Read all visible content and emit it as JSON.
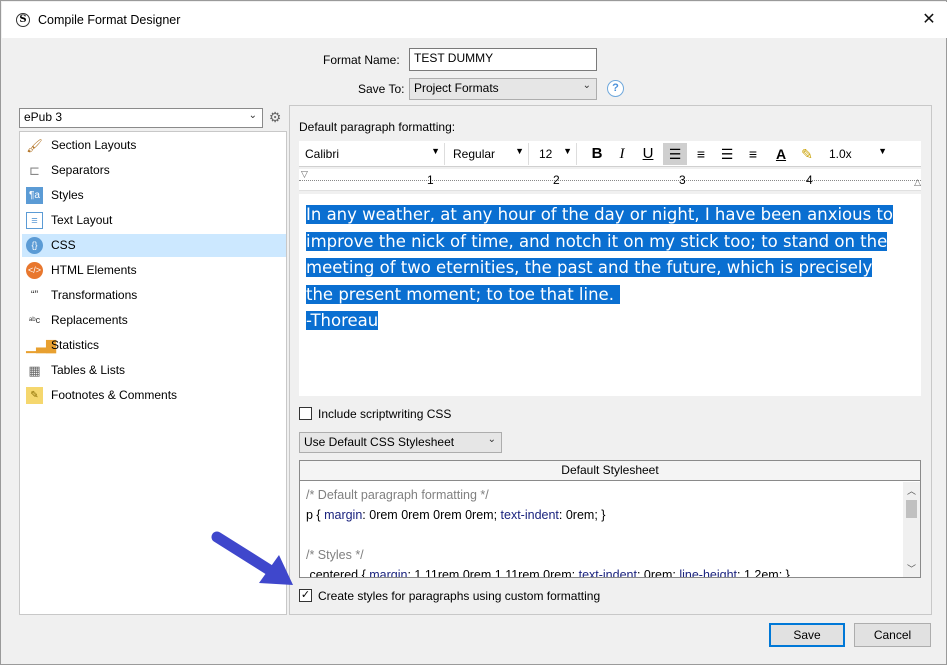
{
  "window": {
    "title": "Compile Format Designer",
    "app_icon_letter": "S"
  },
  "header": {
    "format_name_label": "Format Name:",
    "format_name_value": "TEST DUMMY",
    "save_to_label": "Save To:",
    "save_to_value": "Project Formats",
    "help_glyph": "?"
  },
  "sidebar": {
    "format_select": "ePub 3",
    "items": [
      {
        "label": "Section Layouts",
        "icon": "brush-icon"
      },
      {
        "label": "Separators",
        "icon": "separator-icon"
      },
      {
        "label": "Styles",
        "icon": "styles-icon"
      },
      {
        "label": "Text Layout",
        "icon": "text-layout-icon"
      },
      {
        "label": "CSS",
        "icon": "css-icon"
      },
      {
        "label": "HTML Elements",
        "icon": "html-icon"
      },
      {
        "label": "Transformations",
        "icon": "transformations-icon"
      },
      {
        "label": "Replacements",
        "icon": "replacements-icon"
      },
      {
        "label": "Statistics",
        "icon": "statistics-icon"
      },
      {
        "label": "Tables & Lists",
        "icon": "table-icon"
      },
      {
        "label": "Footnotes & Comments",
        "icon": "footnote-icon"
      }
    ],
    "selected_index": 4
  },
  "editor": {
    "heading": "Default paragraph formatting:",
    "font": "Calibri",
    "style": "Regular",
    "size": "12",
    "line_spacing": "1.0x",
    "ruler_numbers": [
      "1",
      "2",
      "3",
      "4"
    ],
    "lines": [
      "In any weather, at any hour of the day or night, I have been anxious to",
      "improve the nick of time, and notch it on my stick too; to stand on the",
      "meeting of two eternities, the past and the future, which is precisely",
      "the present moment; to toe that line.",
      "-Thoreau"
    ]
  },
  "css": {
    "include_scriptwriting_label": "Include scriptwriting CSS",
    "include_scriptwriting_checked": false,
    "stylesheet_select": "Use Default CSS Stylesheet",
    "stylesheet_header": "Default Stylesheet",
    "code": {
      "comment1": "/* Default paragraph formatting */",
      "line2_selector": "p { ",
      "line2_prop1": "margin",
      "line2_val1": ": 0rem 0rem 0rem 0rem;  ",
      "line2_prop2": "text-indent",
      "line2_val2": ": 0rem; }",
      "comment2": "/* Styles */",
      "line4_selector": ".centered { ",
      "line4_prop1": "margin",
      "line4_val1": ": 1.11rem 0rem 1.11rem 0rem; ",
      "line4_prop2": "text-indent",
      "line4_val2": ": 0rem; ",
      "line4_prop3": "line-height",
      "line4_val3": ": 1.2em; }"
    },
    "create_styles_label": "Create styles for paragraphs using custom formatting",
    "create_styles_checked": true
  },
  "footer": {
    "save_label": "Save",
    "cancel_label": "Cancel"
  },
  "colors": {
    "selection": "#0a6fd1",
    "arrow": "#3f47cc",
    "selected_nav": "#cce8ff"
  }
}
